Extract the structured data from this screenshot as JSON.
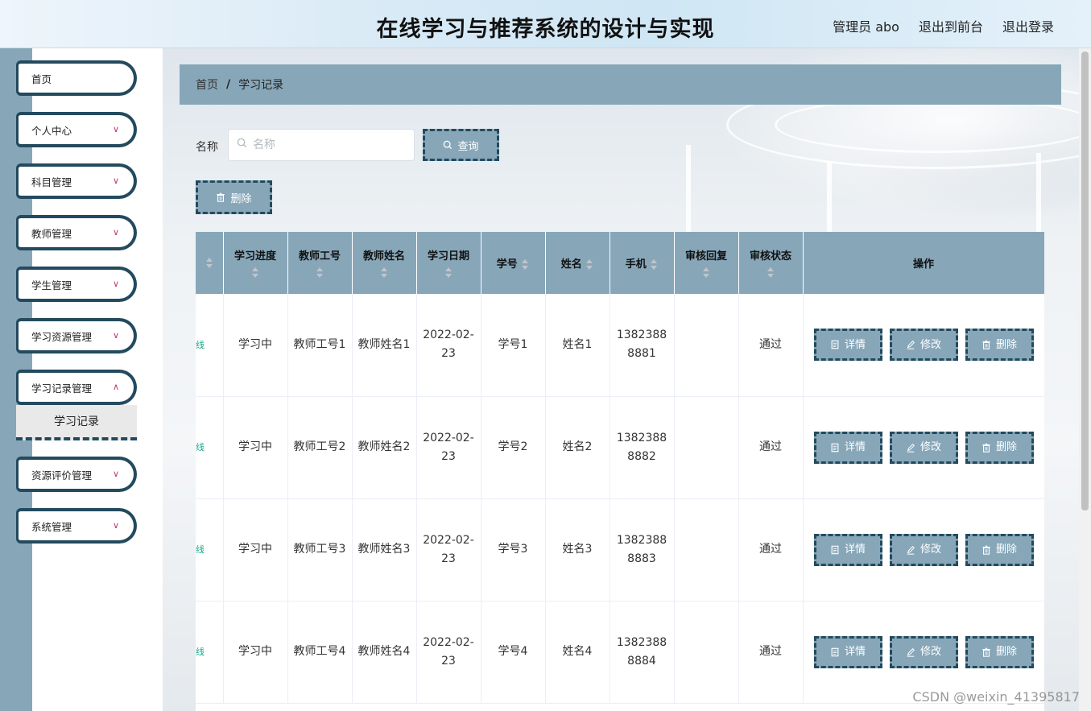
{
  "header": {
    "title": "在线学习与推荐系统的设计与实现",
    "admin": "管理员 abo",
    "back_to_front": "退出到前台",
    "logout": "退出登录"
  },
  "sidebar": {
    "items": [
      {
        "label": "首页"
      },
      {
        "label": "个人中心"
      },
      {
        "label": "科目管理"
      },
      {
        "label": "教师管理"
      },
      {
        "label": "学生管理"
      },
      {
        "label": "学习资源管理"
      },
      {
        "label": "学习记录管理"
      },
      {
        "label": "资源评价管理"
      },
      {
        "label": "系统管理"
      }
    ],
    "active_sub": "学习记录"
  },
  "breadcrumb": {
    "home": "首页",
    "separator": "/",
    "current": "学习记录"
  },
  "search": {
    "label": "名称",
    "placeholder": "名称",
    "button": "查询"
  },
  "toolbar": {
    "delete": "删除"
  },
  "table": {
    "partial_col_text": "线",
    "headers": [
      "学习进度",
      "教师工号",
      "教师姓名",
      "学习日期",
      "学号",
      "姓名",
      "手机",
      "审核回复",
      "审核状态",
      "操作"
    ],
    "rows": [
      {
        "progress": "学习中",
        "teacher_id": "教师工号1",
        "teacher_name": "教师姓名1",
        "date": "2022-02-23",
        "student_id": "学号1",
        "name": "姓名1",
        "phone": "13823888881",
        "reply": "",
        "status": "通过"
      },
      {
        "progress": "学习中",
        "teacher_id": "教师工号2",
        "teacher_name": "教师姓名2",
        "date": "2022-02-23",
        "student_id": "学号2",
        "name": "姓名2",
        "phone": "13823888882",
        "reply": "",
        "status": "通过"
      },
      {
        "progress": "学习中",
        "teacher_id": "教师工号3",
        "teacher_name": "教师姓名3",
        "date": "2022-02-23",
        "student_id": "学号3",
        "name": "姓名3",
        "phone": "13823888883",
        "reply": "",
        "status": "通过"
      },
      {
        "progress": "学习中",
        "teacher_id": "教师工号4",
        "teacher_name": "教师姓名4",
        "date": "2022-02-23",
        "student_id": "学号4",
        "name": "姓名4",
        "phone": "13823888884",
        "reply": "",
        "status": "通过"
      }
    ],
    "actions": {
      "detail": "详情",
      "edit": "修改",
      "delete": "删除"
    }
  },
  "watermark": "CSDN @weixin_41395817",
  "colors": {
    "accent": "#87a7b9",
    "dark_border": "#234a5e",
    "link_green": "#1aa68e"
  }
}
